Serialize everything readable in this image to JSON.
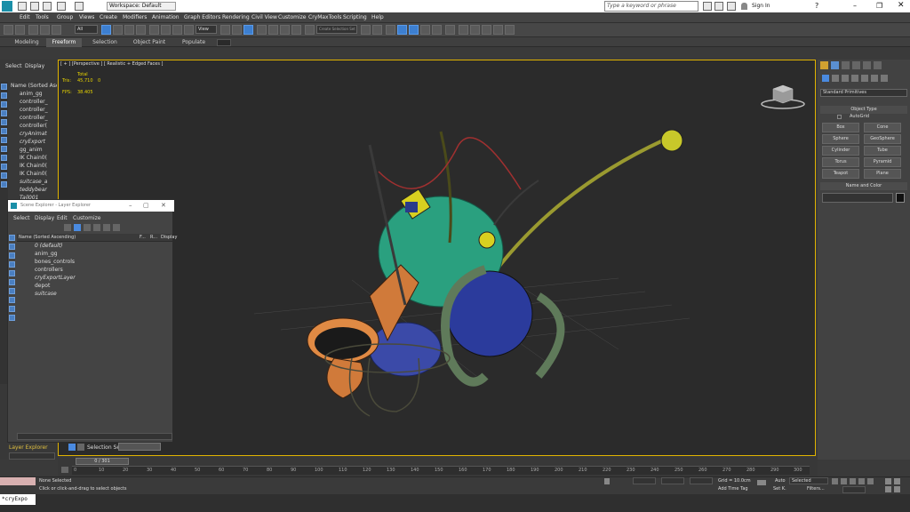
{
  "titlebar": {
    "workspace": "Workspace: Default",
    "search_placeholder": "Type a keyword or phrase",
    "sign_in": "Sign In"
  },
  "menu": [
    "Edit",
    "Tools",
    "Group",
    "Views",
    "Create",
    "Modifiers",
    "Animation",
    "Graph Editors",
    "Rendering",
    "Civil View",
    "Customize",
    "CryMaxTools",
    "Scripting",
    "Help"
  ],
  "toolbar": {
    "selection_filter": "All",
    "ref_coord": "View",
    "named_selection": "Create Selection Set"
  },
  "ribbon": {
    "tabs": [
      "Modeling",
      "Freeform",
      "Selection",
      "Object Paint",
      "Populate"
    ],
    "active": "Freeform"
  },
  "left_panel": {
    "tabs": [
      "Select",
      "Display"
    ],
    "header": "Name (Sorted Asc",
    "rows": [
      "anim_gg",
      "controller_",
      "controller_",
      "controller_",
      "controller(",
      "cryAnimat",
      "cryExport",
      "gg_anim",
      "IK Chain0(",
      "IK Chain0(",
      "IK Chain0(",
      "suitcase_a",
      "teddybear",
      "Tail001"
    ]
  },
  "viewport": {
    "label": "[ + ] [Perspective ] [ Realistic + Edged Faces ]",
    "stats": {
      "total_label": "Total",
      "tris_label": "Tris:",
      "tris_value": "45,710",
      "tris_sel": "0",
      "fps_label": "FPS:",
      "fps_value": "38.405"
    }
  },
  "scene_explorer": {
    "title": "Scene Explorer - Layer Explorer",
    "menus": [
      "Select",
      "Display",
      "Edit",
      "Customize"
    ],
    "columns": [
      "Name (Sorted Ascending)",
      "F...",
      "R...",
      "Display"
    ],
    "rows": [
      "0 (default)",
      "anim_gg",
      "bones_controls",
      "controllers",
      "cryExportLayer",
      "depot",
      "suitcase"
    ],
    "footer_label": "Layer Explorer",
    "selection_set_label": "Selection Set:"
  },
  "command_panel": {
    "dropdown": "Standard Primitives",
    "object_type_header": "Object Type",
    "autogrid": "AutoGrid",
    "buttons": [
      "Box",
      "Cone",
      "Sphere",
      "GeoSphere",
      "Cylinder",
      "Tube",
      "Torus",
      "Pyramid",
      "Teapot",
      "Plane"
    ],
    "name_color_header": "Name and Color"
  },
  "timeline": {
    "frame": "0 / 301",
    "ticks": [
      "0",
      "10",
      "20",
      "30",
      "40",
      "50",
      "60",
      "70",
      "80",
      "90",
      "100",
      "110",
      "120",
      "130",
      "140",
      "150",
      "160",
      "170",
      "180",
      "190",
      "200",
      "210",
      "220",
      "230",
      "240",
      "250",
      "260",
      "270",
      "280",
      "290",
      "300"
    ]
  },
  "status": {
    "selected": "None Selected",
    "hint": "Click or click-and-drag to select objects",
    "grid": "Grid = 10.0cm",
    "add_time_tag": "Add Time Tag",
    "auto": "Auto",
    "set_k": "Set K.",
    "selected_dropdown": "Selected",
    "filters": "Filters..."
  },
  "maxscript": "*cryExpo"
}
